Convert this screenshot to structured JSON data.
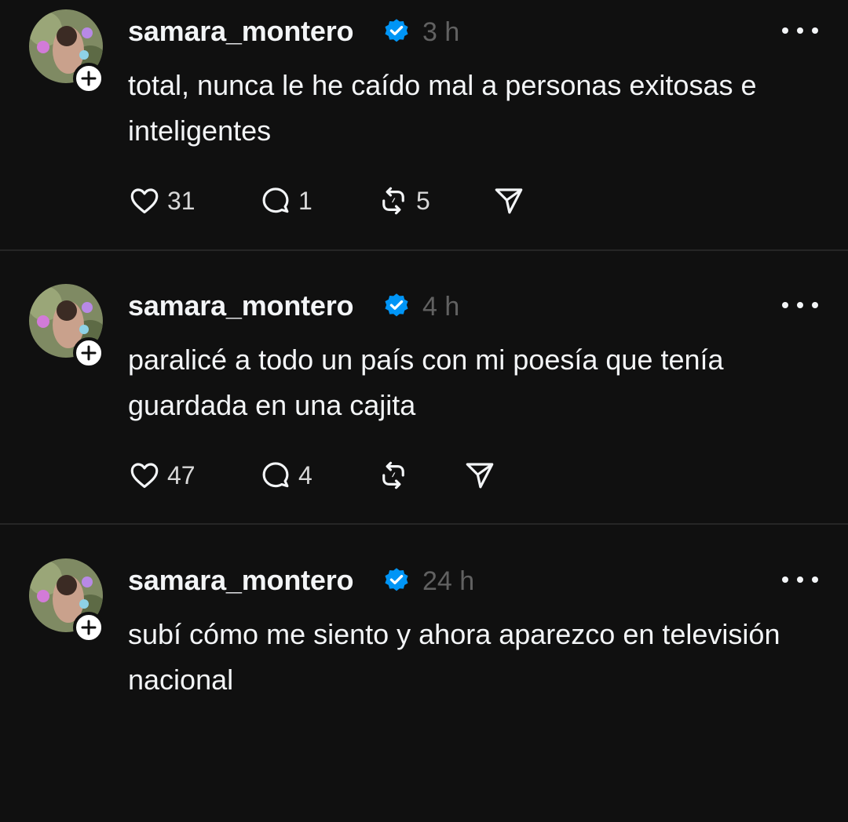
{
  "posts": [
    {
      "username": "samara_montero",
      "timestamp": "3 h",
      "text": "total, nunca le he caído mal a personas exitosas e inteligentes",
      "likes": "31",
      "replies": "1",
      "reposts": "5"
    },
    {
      "username": "samara_montero",
      "timestamp": "4 h",
      "text": "paralicé a todo un país con mi poesía que tenía guardada en una cajita",
      "likes": "47",
      "replies": "4",
      "reposts": ""
    },
    {
      "username": "samara_montero",
      "timestamp": "24 h",
      "text": "subí cómo me siento y ahora aparezco en televisión nacional",
      "likes": "",
      "replies": "",
      "reposts": ""
    }
  ],
  "icons": {
    "verified": "verified-badge-icon",
    "more": "more-options-icon",
    "like": "heart-icon",
    "reply": "comment-icon",
    "repost": "repost-icon",
    "share": "send-icon",
    "follow": "plus-icon"
  },
  "colors": {
    "background": "#101010",
    "text": "#f3f5f7",
    "muted": "#616161",
    "verified": "#0095f6",
    "divider": "#262626"
  }
}
